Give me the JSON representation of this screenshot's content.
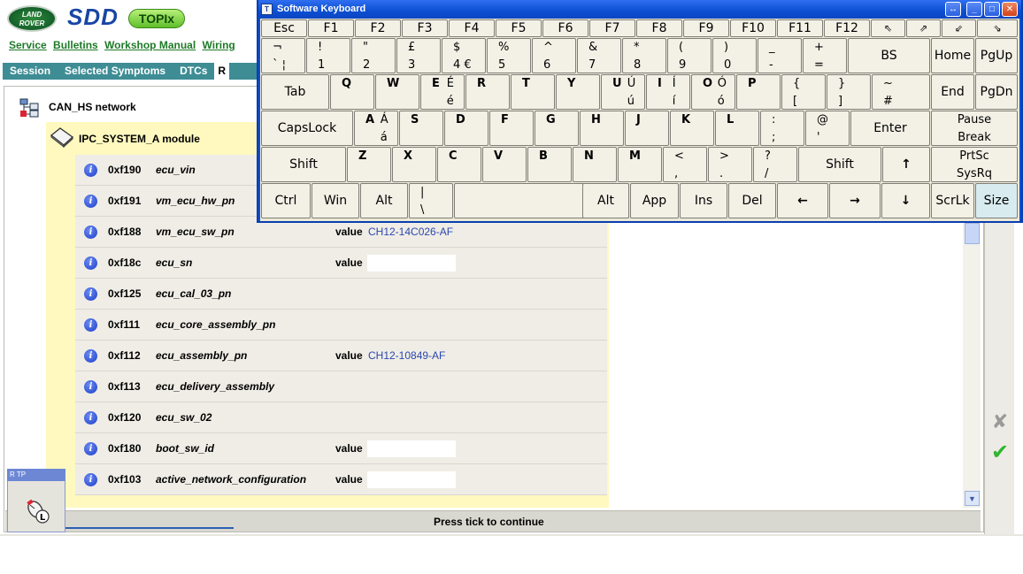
{
  "header": {
    "logo_text": "LAND ROVER",
    "app_name": "SDD",
    "topix_label": "TOPIx",
    "nav_links": [
      "Service",
      "Bulletins",
      "Workshop Manual",
      "Wiring"
    ],
    "session_tabs": [
      "Session",
      "Selected Symptoms",
      "DTCs",
      "R"
    ]
  },
  "tree": {
    "network_label": "CAN_HS network",
    "module_label": "IPC_SYSTEM_A module"
  },
  "value_label": "value",
  "rows": [
    {
      "code": "0xf190",
      "name": "ecu_vin"
    },
    {
      "code": "0xf191",
      "name": "vm_ecu_hw_pn"
    },
    {
      "code": "0xf188",
      "name": "vm_ecu_sw_pn",
      "value": "CH12-14C026-AF"
    },
    {
      "code": "0xf18c",
      "name": "ecu_sn",
      "value": ""
    },
    {
      "code": "0xf125",
      "name": "ecu_cal_03_pn"
    },
    {
      "code": "0xf111",
      "name": "ecu_core_assembly_pn"
    },
    {
      "code": "0xf112",
      "name": "ecu_assembly_pn",
      "value": "CH12-10849-AF"
    },
    {
      "code": "0xf113",
      "name": "ecu_delivery_assembly"
    },
    {
      "code": "0xf120",
      "name": "ecu_sw_02"
    },
    {
      "code": "0xf180",
      "name": "boot_sw_id",
      "value": ""
    },
    {
      "code": "0xf103",
      "name": "active_network_configuration",
      "value": ""
    }
  ],
  "status": {
    "text": "Press tick to continue",
    "rtp_label": "R TP"
  },
  "keyboard": {
    "title": "Software Keyboard",
    "title_icon": "T",
    "row1": [
      "Esc",
      "F1",
      "F2",
      "F3",
      "F4",
      "F5",
      "F6",
      "F7",
      "F8",
      "F9",
      "F10",
      "F11",
      "F12"
    ],
    "row2": [
      {
        "t": "¬",
        "b": "` ¦"
      },
      {
        "t": "!",
        "b": "1"
      },
      {
        "t": "\"",
        "b": "2"
      },
      {
        "t": "£",
        "b": "3"
      },
      {
        "t": "$",
        "b": "4  €"
      },
      {
        "t": "%",
        "b": "5"
      },
      {
        "t": "^",
        "b": "6"
      },
      {
        "t": "&",
        "b": "7"
      },
      {
        "t": "*",
        "b": "8"
      },
      {
        "t": "(",
        "b": "9"
      },
      {
        "t": ")",
        "b": "0"
      },
      {
        "t": "_",
        "b": "-"
      },
      {
        "t": "+",
        "b": "="
      }
    ],
    "bs": "BS",
    "home": "Home",
    "pgup": "PgUp",
    "tab": "Tab",
    "row3": [
      {
        "l": "Q"
      },
      {
        "l": "W"
      },
      {
        "l": "E",
        "r": "É",
        "rb": "é"
      },
      {
        "l": "R"
      },
      {
        "l": "T"
      },
      {
        "l": "Y"
      },
      {
        "l": "U",
        "r": "Ú",
        "rb": "ú"
      },
      {
        "l": "I",
        "r": "Í",
        "rb": "í"
      },
      {
        "l": "O",
        "r": "Ó",
        "rb": "ó"
      },
      {
        "l": "P"
      },
      {
        "t": "{",
        "b": "["
      },
      {
        "t": "}",
        "b": "]"
      },
      {
        "t": "~",
        "b": "#"
      }
    ],
    "end": "End",
    "pgdn": "PgDn",
    "capslock": "CapsLock",
    "row4": [
      {
        "l": "A",
        "r": "Á",
        "rb": "á"
      },
      {
        "l": "S"
      },
      {
        "l": "D"
      },
      {
        "l": "F"
      },
      {
        "l": "G"
      },
      {
        "l": "H"
      },
      {
        "l": "J"
      },
      {
        "l": "K"
      },
      {
        "l": "L"
      },
      {
        "t": ":",
        "b": ";"
      },
      {
        "t": "@",
        "b": "'"
      }
    ],
    "enter": "Enter",
    "pause_top": "Pause",
    "pause_bottom": "Break",
    "shift": "Shift",
    "row5": [
      {
        "l": "Z"
      },
      {
        "l": "X"
      },
      {
        "l": "C"
      },
      {
        "l": "V"
      },
      {
        "l": "B"
      },
      {
        "l": "N"
      },
      {
        "l": "M"
      },
      {
        "t": "<",
        "b": ","
      },
      {
        "t": ">",
        "b": "."
      },
      {
        "t": "?",
        "b": "/"
      }
    ],
    "up_arrow": "↑",
    "prtsc_top": "PrtSc",
    "prtsc_bottom": "SysRq",
    "ctrl": "Ctrl",
    "win": "Win",
    "alt": "Alt",
    "pipe_top": "|",
    "pipe_bottom": "\\",
    "alt_gr": "Alt",
    "app": "App",
    "ins": "Ins",
    "del": "Del",
    "left_arrow": "←",
    "right_arrow": "→",
    "down_arrow": "↓",
    "scrlk": "ScrLk",
    "size": "Size"
  }
}
